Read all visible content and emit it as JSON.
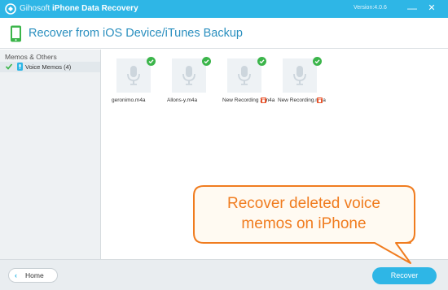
{
  "titlebar": {
    "brand": "Gihosoft",
    "product": "iPhone Data Recovery",
    "version": "Version:4.0.6",
    "logo_icon": "gihosoft-logo-icon",
    "minimize_icon": "minimize-icon",
    "close_icon": "close-icon"
  },
  "header": {
    "device_icon": "phone-icon",
    "title": "Recover from iOS Device/iTunes Backup"
  },
  "sidebar": {
    "group_label": "Memos & Others",
    "items": [
      {
        "label": "Voice Memos (4)",
        "checked": true,
        "icon": "microphone-icon"
      }
    ]
  },
  "files": [
    {
      "name": "geronimo.m4a",
      "selected": true,
      "deleted": false
    },
    {
      "name": "Allons-y.m4a",
      "selected": true,
      "deleted": false
    },
    {
      "name": "New Recording 2.m4a",
      "selected": true,
      "deleted": true
    },
    {
      "name": "New Recording.m4a",
      "selected": true,
      "deleted": true
    }
  ],
  "footer": {
    "home_label": "Home",
    "recover_label": "Recover"
  },
  "callout": {
    "text_line1": "Recover deleted voice",
    "text_line2": "memos on iPhone"
  },
  "colors": {
    "accent": "#2eb6e6",
    "heading": "#2a8fbf",
    "check": "#3bb54a",
    "delete": "#e8542c",
    "callout_orange": "#f07c1f"
  }
}
